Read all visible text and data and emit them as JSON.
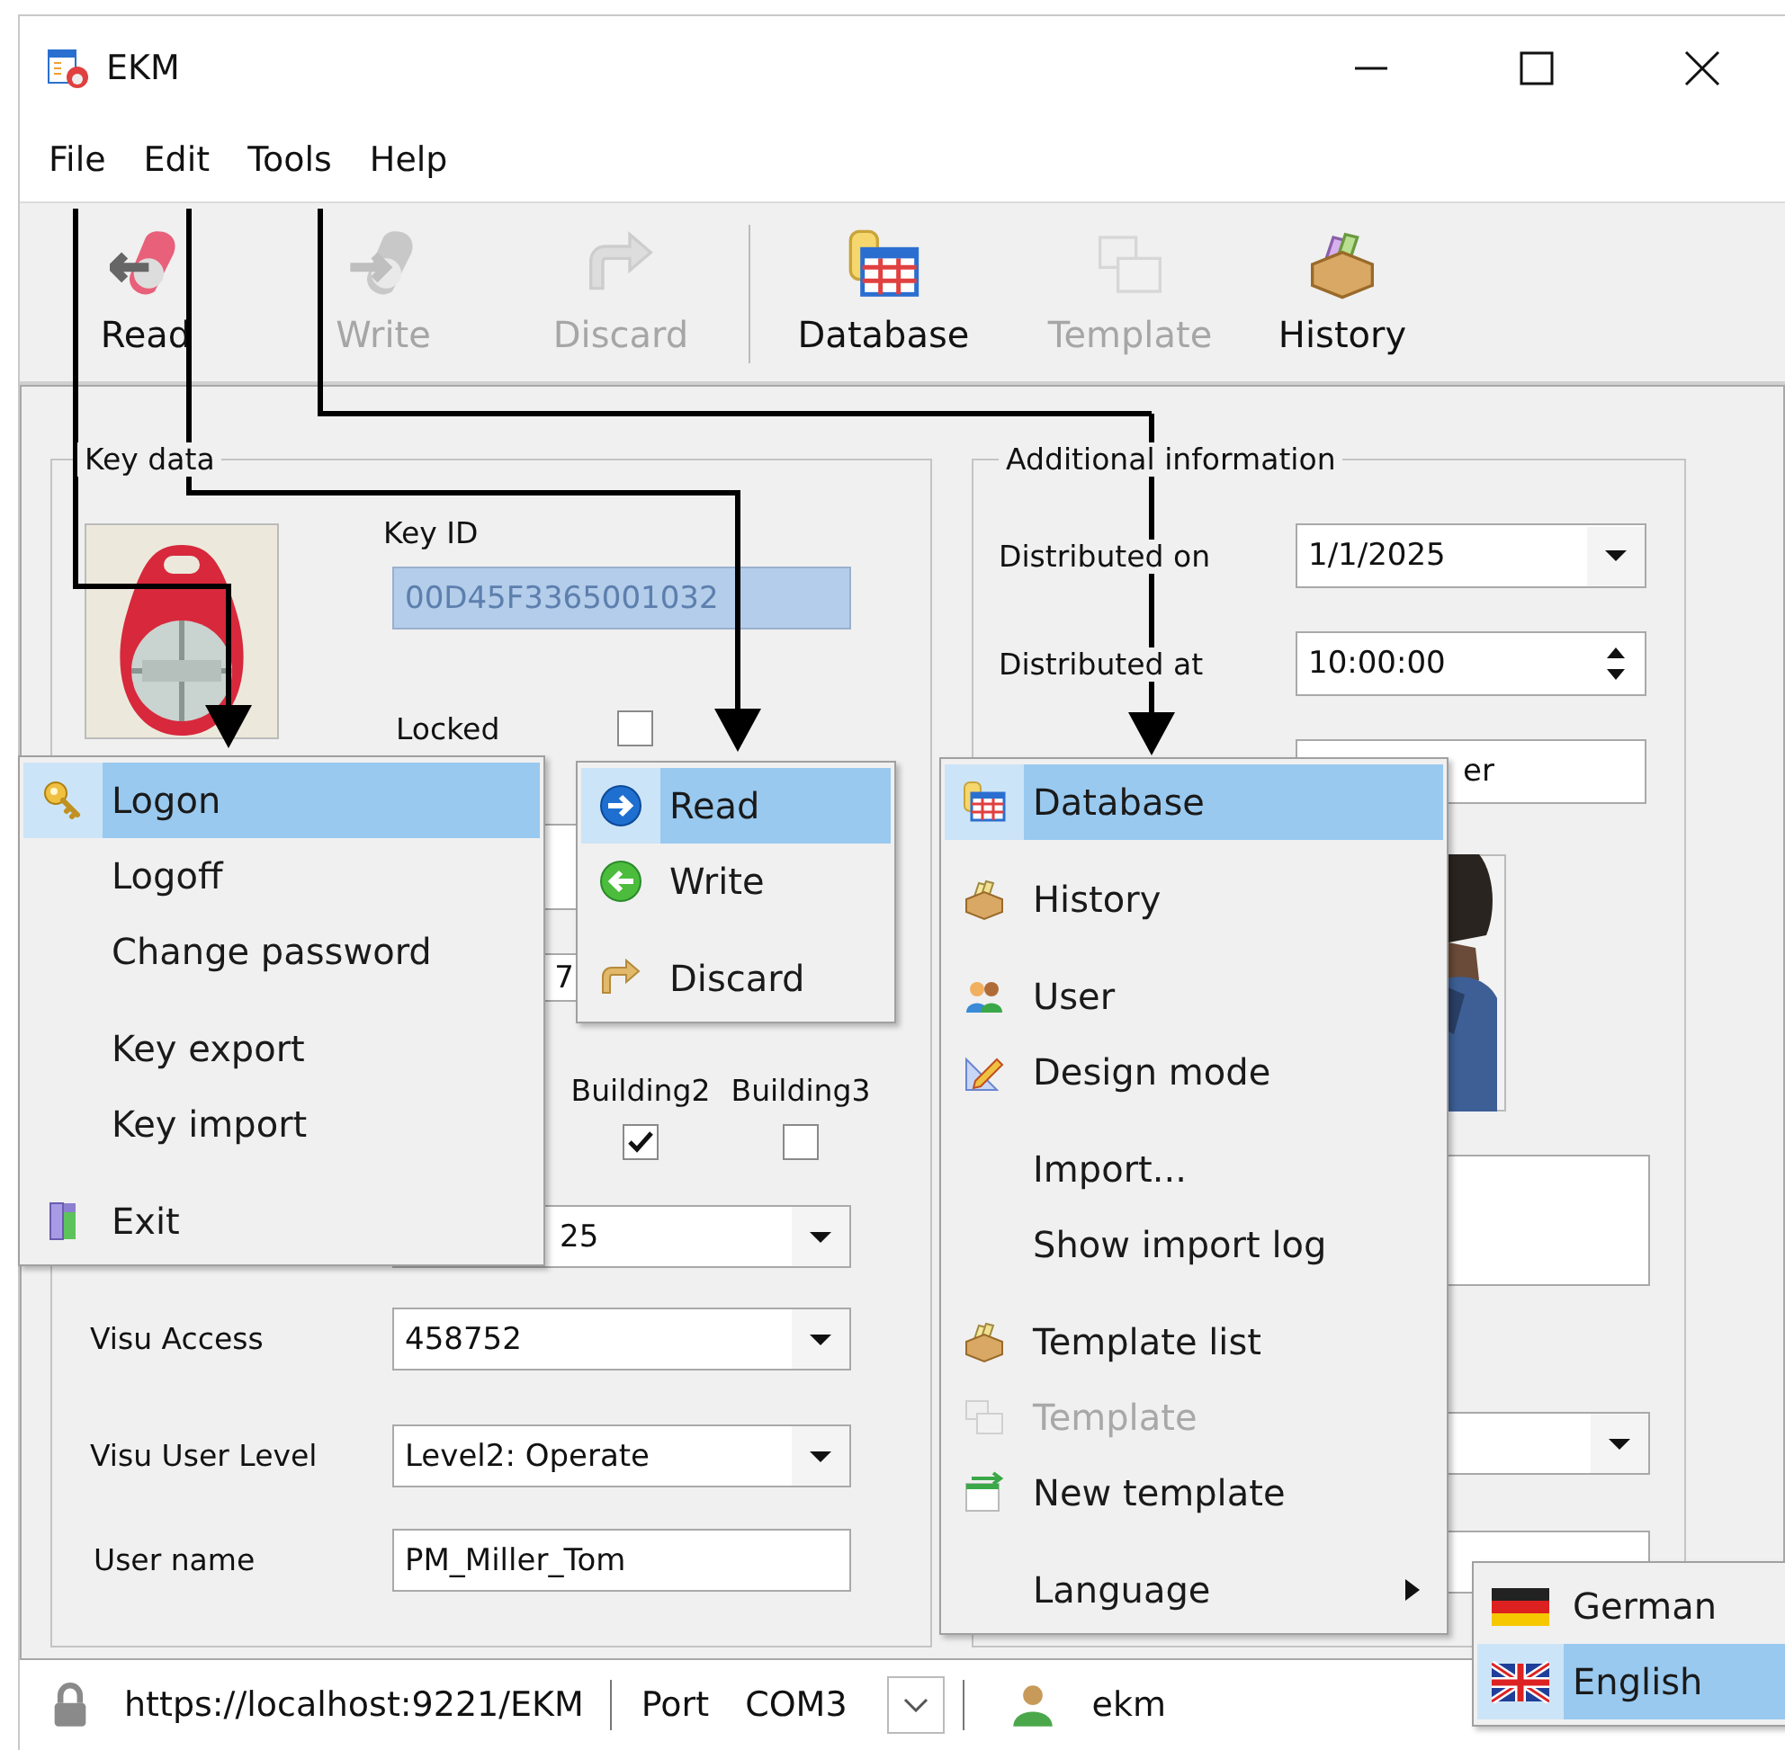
{
  "window": {
    "title": "EKM"
  },
  "menu_bar": [
    {
      "label": "File"
    },
    {
      "label": "Edit"
    },
    {
      "label": "Tools"
    },
    {
      "label": "Help"
    }
  ],
  "toolbar": [
    {
      "label": "Read",
      "disabled": false
    },
    {
      "label": "Write",
      "disabled": true
    },
    {
      "label": "Discard",
      "disabled": true
    },
    {
      "label": "Database",
      "disabled": false
    },
    {
      "label": "Template",
      "disabled": true
    },
    {
      "label": "History",
      "disabled": false
    }
  ],
  "key_data": {
    "title": "Key data",
    "key_id": {
      "label": "Key ID",
      "value": "00D45F3365001032",
      "disabled": true
    },
    "locked": {
      "label": "Locked",
      "checked": false
    },
    "field_4": {
      "value": "7"
    },
    "buildings": [
      {
        "label": "Building2",
        "checked": true
      },
      {
        "label": "Building3",
        "checked": false
      }
    ],
    "field_6": {
      "value": "25"
    },
    "visu_access": {
      "label": "Visu Access",
      "value": "458752"
    },
    "visu_user_level": {
      "label": "Visu User Level",
      "value": "Level2: Operate"
    },
    "user_name": {
      "label": "User name",
      "value": "PM_Miller_Tom"
    }
  },
  "additional_information": {
    "title": "Additional information",
    "distributed_on": {
      "label": "Distributed on",
      "value": "1/1/2025"
    },
    "distributed_at": {
      "label": "Distributed at",
      "value": "10:00:00"
    },
    "field_3": {
      "value": "er"
    }
  },
  "file_menu": {
    "groups": [
      [
        {
          "label": "Logon",
          "selected": true
        },
        {
          "label": "Logoff",
          "selected": false
        },
        {
          "label": "Change password",
          "selected": false
        }
      ],
      [
        {
          "label": "Key export",
          "selected": false
        },
        {
          "label": "Key import",
          "selected": false
        }
      ],
      [
        {
          "label": "Exit",
          "selected": false
        }
      ]
    ]
  },
  "edit_menu": {
    "groups": [
      [
        {
          "label": "Read",
          "selected": true
        },
        {
          "label": "Write",
          "selected": false
        }
      ],
      [
        {
          "label": "Discard",
          "selected": false
        }
      ]
    ]
  },
  "tools_menu": {
    "groups": [
      [
        {
          "label": "Database",
          "selected": true,
          "disabled": false,
          "has_submenu": false
        }
      ],
      [
        {
          "label": "History",
          "selected": false,
          "disabled": false,
          "has_submenu": false
        }
      ],
      [
        {
          "label": "User",
          "selected": false,
          "disabled": false,
          "has_submenu": false
        },
        {
          "label": "Design mode",
          "selected": false,
          "disabled": false,
          "has_submenu": false
        }
      ],
      [
        {
          "label": "Import...",
          "selected": false,
          "disabled": false,
          "has_submenu": false
        },
        {
          "label": "Show import log",
          "selected": false,
          "disabled": false,
          "has_submenu": false
        }
      ],
      [
        {
          "label": "Template list",
          "selected": false,
          "disabled": false,
          "has_submenu": false
        },
        {
          "label": "Template",
          "selected": false,
          "disabled": true,
          "has_submenu": false
        },
        {
          "label": "New template",
          "selected": false,
          "disabled": false,
          "has_submenu": false
        }
      ],
      [
        {
          "label": "Language",
          "selected": false,
          "disabled": false,
          "has_submenu": true
        }
      ]
    ]
  },
  "language_menu": {
    "items": [
      {
        "label": "German",
        "selected": false
      },
      {
        "label": "English",
        "selected": true
      }
    ]
  },
  "status_bar": {
    "url": "https://localhost:9221/EKM",
    "port_label": "Port",
    "port": "COM3",
    "user": "ekm"
  }
}
